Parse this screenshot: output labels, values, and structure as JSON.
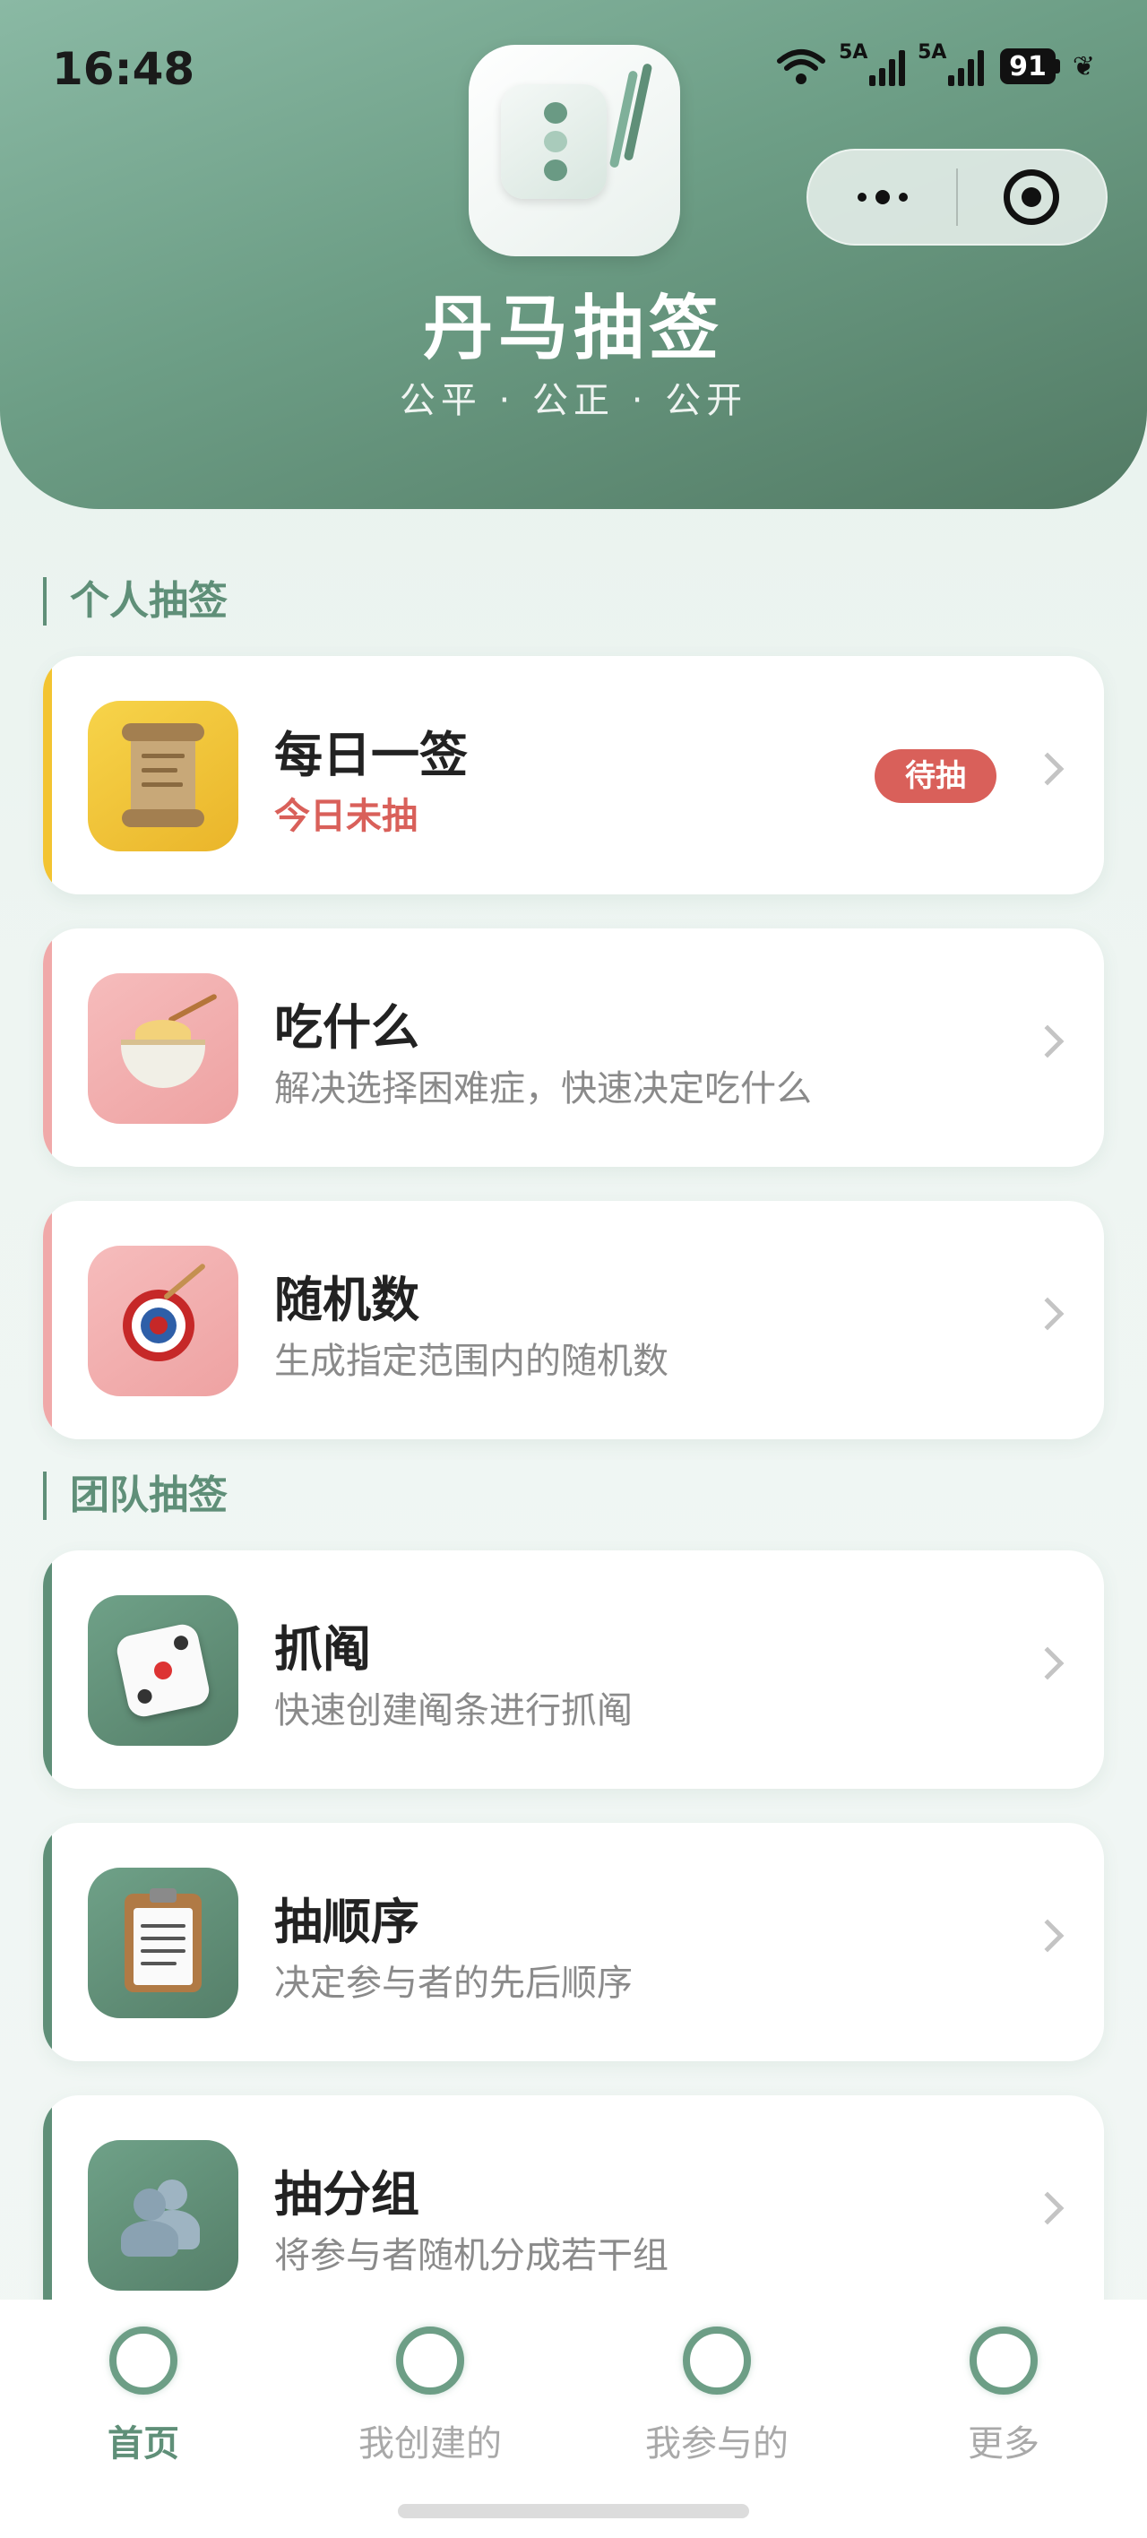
{
  "status_bar": {
    "time": "16:48",
    "network_1": "5A",
    "network_2": "5A",
    "battery": "91",
    "icons": [
      "wifi-icon",
      "signal-icon",
      "signal-icon",
      "battery-icon",
      "leaf-icon"
    ]
  },
  "header": {
    "title": "丹马抽签",
    "subtitle": "公平 · 公正 · 公开",
    "logo_icon": "lottery-tube-icon",
    "capsule_icons": [
      "more-dots-icon",
      "close-target-icon"
    ]
  },
  "sections": {
    "personal_title": "个人抽签",
    "team_title": "团队抽签"
  },
  "personal_cards": [
    {
      "name": "每日一签",
      "desc": "今日未抽",
      "badge": "待抽",
      "icon": "scroll-icon",
      "accent": "#f3c431",
      "icon_bg": "#f3c431"
    },
    {
      "name": "吃什么",
      "desc": "解决选择困难症，快速决定吃什么",
      "icon": "noodle-bowl-icon",
      "accent": "#f0a9a9",
      "icon_bg": "#f4b4b4"
    },
    {
      "name": "随机数",
      "desc": "生成指定范围内的随机数",
      "icon": "dart-target-icon",
      "accent": "#f0a9a9",
      "icon_bg": "#f4b4b4"
    }
  ],
  "team_cards": [
    {
      "name": "抓阄",
      "desc": "快速创建阄条进行抓阄",
      "icon": "dice-icon",
      "accent": "#5f8f78",
      "icon_bg": "#5f8f78"
    },
    {
      "name": "抽顺序",
      "desc": "决定参与者的先后顺序",
      "icon": "clipboard-icon",
      "accent": "#5f8f78",
      "icon_bg": "#5f8f78"
    },
    {
      "name": "抽分组",
      "desc": "将参与者随机分成若干组",
      "icon": "people-icon",
      "accent": "#5f8f78",
      "icon_bg": "#5f8f78"
    }
  ],
  "tabbar": {
    "items": [
      {
        "label": "首页",
        "active": true
      },
      {
        "label": "我创建的",
        "active": false
      },
      {
        "label": "我参与的",
        "active": false
      },
      {
        "label": "更多",
        "active": false
      }
    ]
  },
  "colors": {
    "brand": "#5f8f78",
    "alert": "#d9605a"
  }
}
